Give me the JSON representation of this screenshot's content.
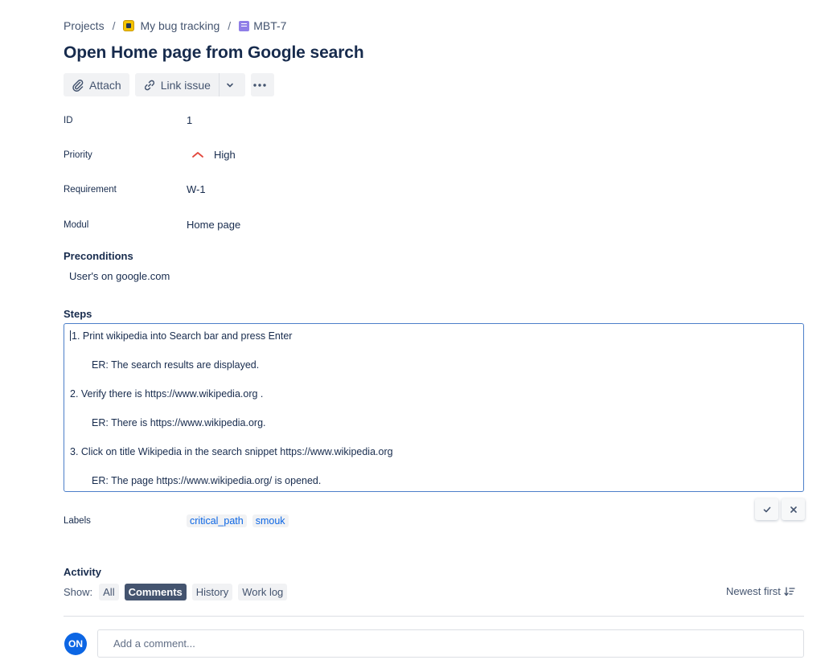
{
  "breadcrumb": {
    "projects": "Projects",
    "separator": "/",
    "project": "My bug tracking",
    "issue_key": "MBT-7"
  },
  "issue": {
    "title": "Open Home page from Google search"
  },
  "toolbar": {
    "attach": "Attach",
    "link_issue": "Link issue"
  },
  "fields": {
    "id": {
      "label": "ID",
      "value": "1"
    },
    "priority": {
      "label": "Priority",
      "value": "High",
      "color": "#e2483d"
    },
    "requirement": {
      "label": "Requirement",
      "value": "W-1"
    },
    "modul": {
      "label": "Modul",
      "value": "Home page"
    }
  },
  "preconditions": {
    "heading": "Preconditions",
    "text": "User's on google.com"
  },
  "steps": {
    "heading": "Steps",
    "lines": [
      "1. Print wikipedia into Search bar and press Enter",
      "ER: The search results are displayed.",
      "2. Verify there is https://www.wikipedia.org .",
      "ER: There is https://www.wikipedia.org.",
      "3. Click on title Wikipedia in the search snippet https://www.wikipedia.org",
      "ER: The page https://www.wikipedia.org/ is opened."
    ]
  },
  "labels": {
    "label": "Labels",
    "items": [
      "critical_path",
      "smouk"
    ]
  },
  "activity": {
    "heading": "Activity",
    "show_label": "Show:",
    "filters": [
      "All",
      "Comments",
      "History",
      "Work log"
    ],
    "active_filter": "Comments",
    "sort": "Newest first",
    "avatar_initials": "ON",
    "comment_placeholder": "Add a comment..."
  },
  "colors": {
    "accent": "#0c66e4",
    "text": "#172b4d",
    "focus_border": "#4c7fc9"
  }
}
